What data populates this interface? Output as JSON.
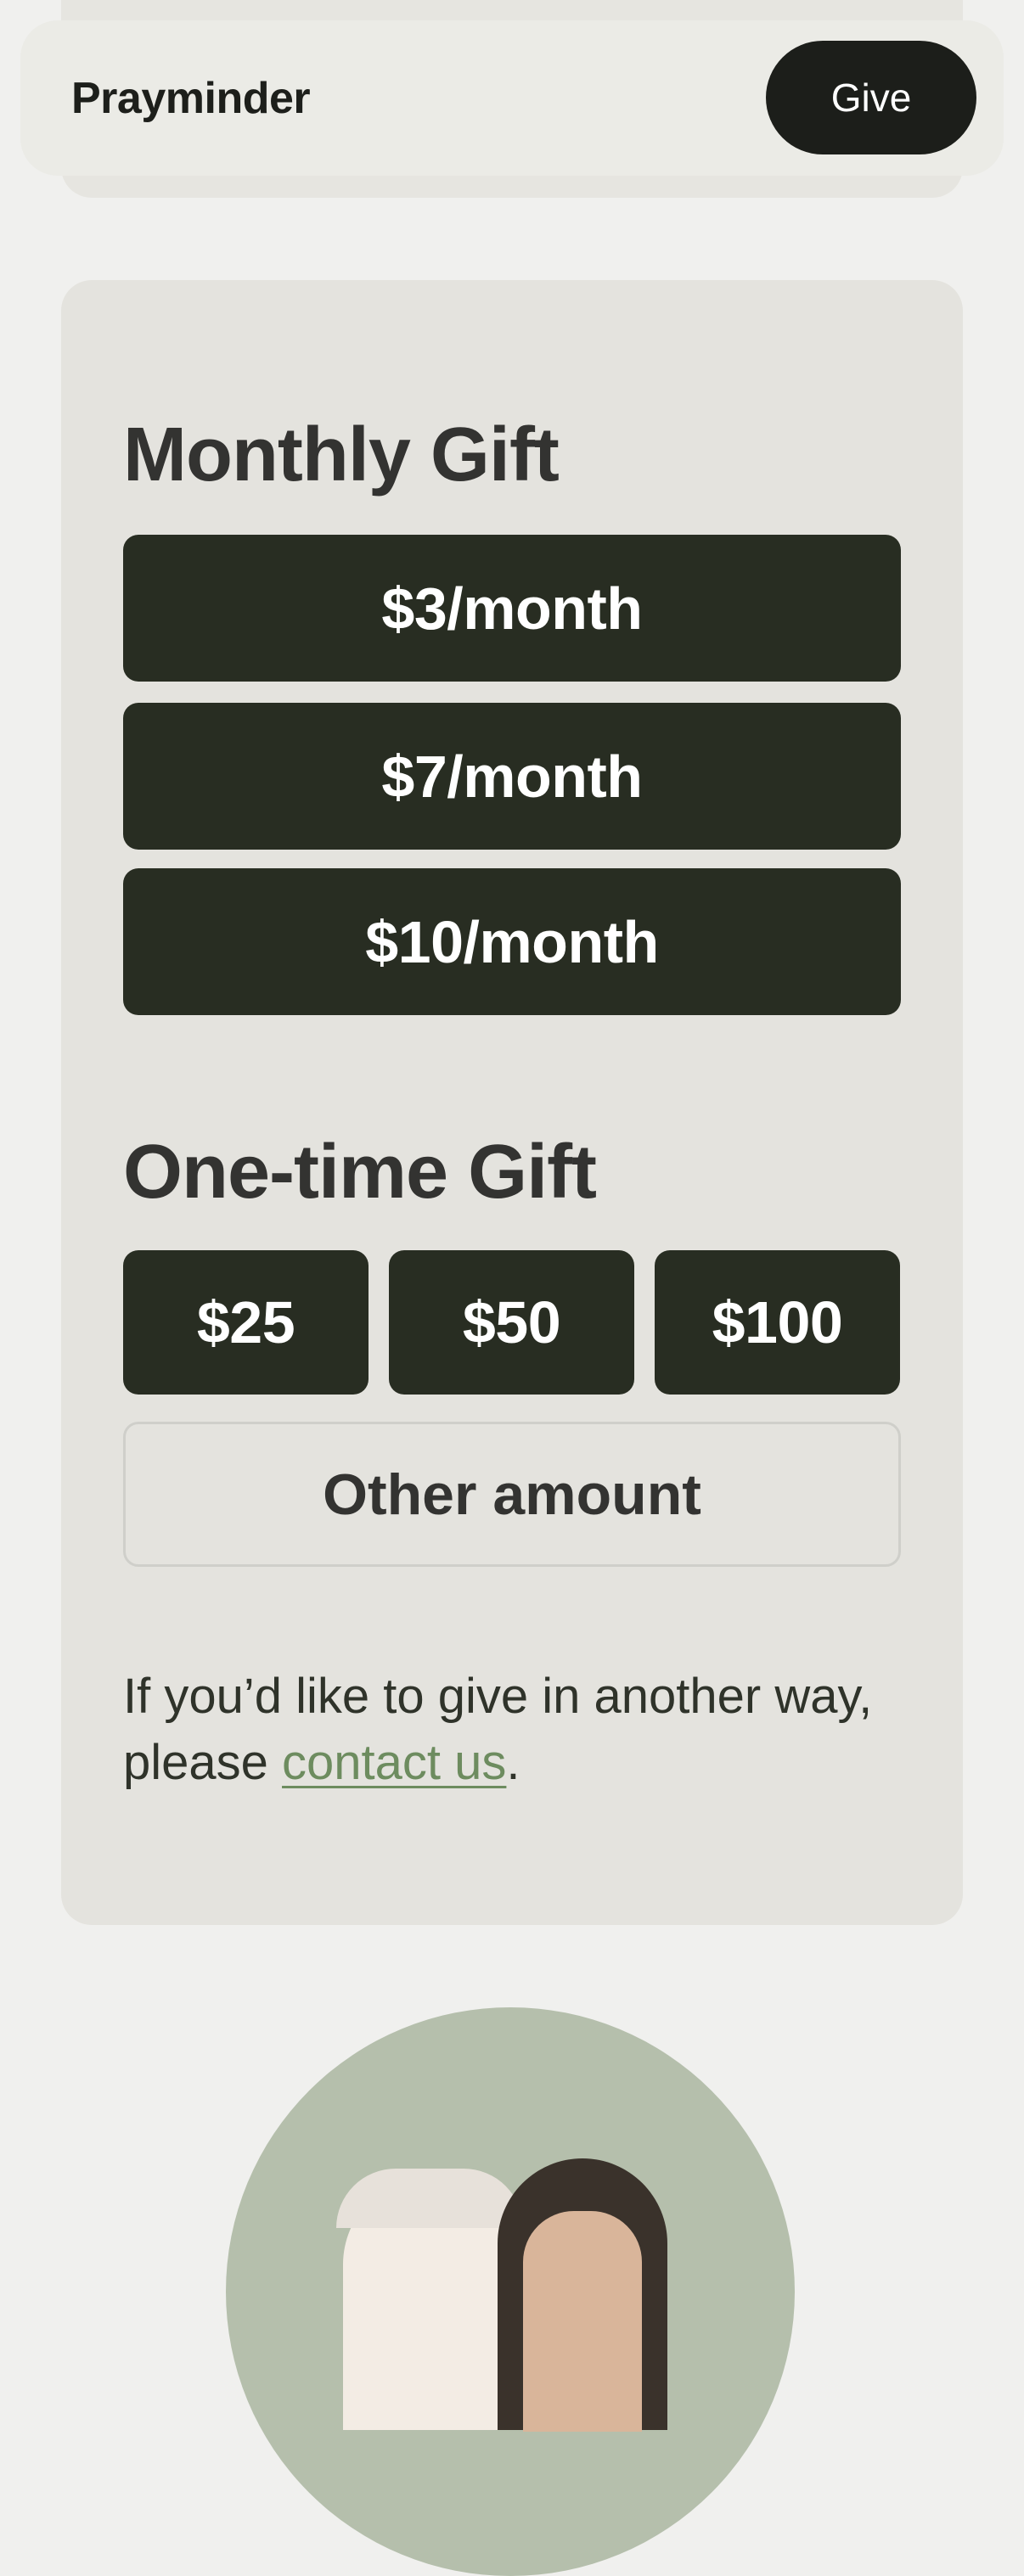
{
  "header": {
    "brand": "Prayminder",
    "give_label": "Give"
  },
  "monthly": {
    "title": "Monthly Gift",
    "options": [
      "$3/month",
      "$7/month",
      "$10/month"
    ]
  },
  "one_time": {
    "title": "One-time Gift",
    "options": [
      "$25",
      "$50",
      "$100"
    ],
    "other_label": "Other amount"
  },
  "footnote": {
    "text_before": "If you’d like to give in another way, please ",
    "link_text": "contact us",
    "text_after": "."
  },
  "colors": {
    "page_background": "#f0f0ee",
    "card_background": "#e4e3de",
    "button_dark": "#282d22",
    "link_green": "#6d8c5f",
    "avatar_background": "#b5bfac"
  }
}
